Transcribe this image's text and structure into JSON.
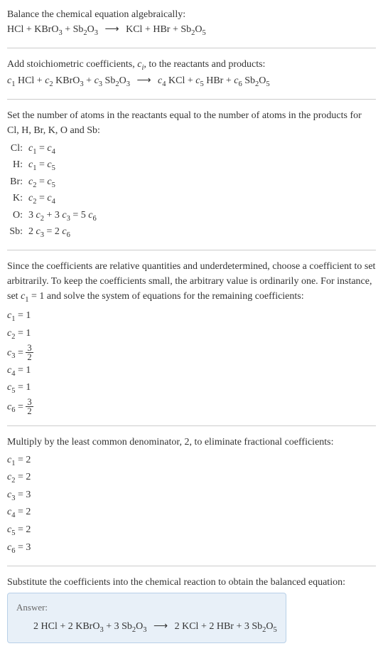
{
  "section1": {
    "line1": "Balance the chemical equation algebraically:",
    "eq_lhs1": "HCl + KBrO",
    "eq_sub1": "3",
    "eq_lhs2": " + Sb",
    "eq_sub2": "2",
    "eq_lhs3": "O",
    "eq_sub3": "3",
    "arrow": " ⟶ ",
    "eq_rhs1": "KCl + HBr + Sb",
    "eq_sub4": "2",
    "eq_rhs2": "O",
    "eq_sub5": "5"
  },
  "section2": {
    "line1_a": "Add stoichiometric coefficients, ",
    "line1_ci": "c",
    "line1_ci_sub": "i",
    "line1_b": ", to the reactants and products:",
    "c1": "c",
    "c1_sub": "1",
    "sp1": " HCl + ",
    "c2": "c",
    "c2_sub": "2",
    "sp2": " KBrO",
    "sub_a": "3",
    "sp3": " + ",
    "c3": "c",
    "c3_sub": "3",
    "sp4": " Sb",
    "sub_b": "2",
    "sp5": "O",
    "sub_c": "3",
    "arrow": " ⟶ ",
    "c4": "c",
    "c4_sub": "4",
    "sp6": " KCl + ",
    "c5": "c",
    "c5_sub": "5",
    "sp7": " HBr + ",
    "c6": "c",
    "c6_sub": "6",
    "sp8": " Sb",
    "sub_d": "2",
    "sp9": "O",
    "sub_e": "5"
  },
  "section3": {
    "line1": "Set the number of atoms in the reactants equal to the number of atoms in the products for Cl, H, Br, K, O and Sb:",
    "rows": [
      {
        "label": "Cl:",
        "eq_a": "c",
        "eq_a_sub": "1",
        "eq_mid": " = ",
        "eq_b": "c",
        "eq_b_sub": "4"
      },
      {
        "label": "H:",
        "eq_a": "c",
        "eq_a_sub": "1",
        "eq_mid": " = ",
        "eq_b": "c",
        "eq_b_sub": "5"
      },
      {
        "label": "Br:",
        "eq_a": "c",
        "eq_a_sub": "2",
        "eq_mid": " = ",
        "eq_b": "c",
        "eq_b_sub": "5"
      },
      {
        "label": "K:",
        "eq_a": "c",
        "eq_a_sub": "2",
        "eq_mid": " = ",
        "eq_b": "c",
        "eq_b_sub": "4"
      }
    ],
    "row_o": {
      "label": "O:",
      "p1": "3 ",
      "c1": "c",
      "c1_sub": "2",
      "p2": " + 3 ",
      "c2": "c",
      "c2_sub": "3",
      "p3": " = 5 ",
      "c3": "c",
      "c3_sub": "6"
    },
    "row_sb": {
      "label": "Sb:",
      "p1": "2 ",
      "c1": "c",
      "c1_sub": "3",
      "p2": " = 2 ",
      "c2": "c",
      "c2_sub": "6"
    }
  },
  "section4": {
    "line1_a": "Since the coefficients are relative quantities and underdetermined, choose a coefficient to set arbitrarily. To keep the coefficients small, the arbitrary value is ordinarily one. For instance, set ",
    "line1_c": "c",
    "line1_c_sub": "1",
    "line1_b": " = 1 and solve the system of equations for the remaining coefficients:",
    "rows": [
      {
        "c": "c",
        "sub": "1",
        "val": " = 1"
      },
      {
        "c": "c",
        "sub": "2",
        "val": " = 1"
      }
    ],
    "row3": {
      "c": "c",
      "sub": "3",
      "eq": " = ",
      "num": "3",
      "den": "2"
    },
    "rows2": [
      {
        "c": "c",
        "sub": "4",
        "val": " = 1"
      },
      {
        "c": "c",
        "sub": "5",
        "val": " = 1"
      }
    ],
    "row6": {
      "c": "c",
      "sub": "6",
      "eq": " = ",
      "num": "3",
      "den": "2"
    }
  },
  "section5": {
    "line1": "Multiply by the least common denominator, 2, to eliminate fractional coefficients:",
    "rows": [
      {
        "c": "c",
        "sub": "1",
        "val": " = 2"
      },
      {
        "c": "c",
        "sub": "2",
        "val": " = 2"
      },
      {
        "c": "c",
        "sub": "3",
        "val": " = 3"
      },
      {
        "c": "c",
        "sub": "4",
        "val": " = 2"
      },
      {
        "c": "c",
        "sub": "5",
        "val": " = 2"
      },
      {
        "c": "c",
        "sub": "6",
        "val": " = 3"
      }
    ]
  },
  "section6": {
    "line1": "Substitute the coefficients into the chemical reaction to obtain the balanced equation:",
    "answer_label": "Answer:",
    "eq_p1": "2 HCl + 2 KBrO",
    "eq_s1": "3",
    "eq_p2": " + 3 Sb",
    "eq_s2": "2",
    "eq_p3": "O",
    "eq_s3": "3",
    "arrow": " ⟶ ",
    "eq_p4": "2 KCl + 2 HBr + 3 Sb",
    "eq_s4": "2",
    "eq_p5": "O",
    "eq_s5": "5"
  }
}
